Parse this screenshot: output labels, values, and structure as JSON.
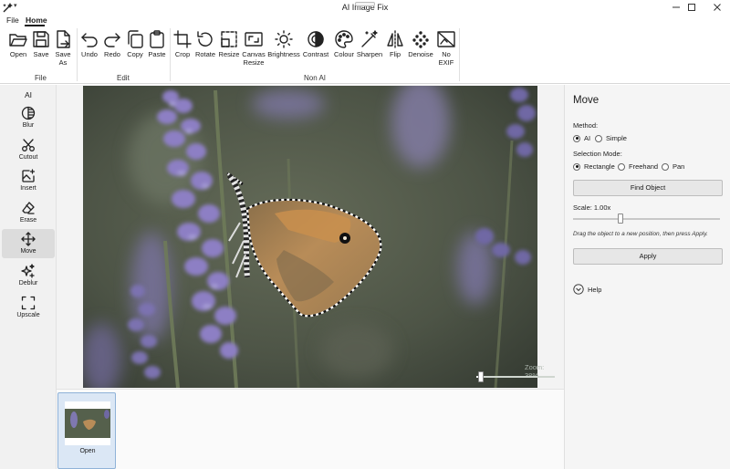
{
  "window": {
    "title": "AI Image Fix",
    "buttons": {
      "minimize": "minimize-icon",
      "maximize": "maximize-icon",
      "close": "close-icon"
    }
  },
  "menu": {
    "file": "File",
    "home": "Home"
  },
  "ribbon": {
    "groups": {
      "file": "File",
      "edit": "Edit",
      "nonai": "Non AI"
    },
    "tools": {
      "open": "Open",
      "save": "Save",
      "save_as_1": "Save",
      "save_as_2": "As",
      "undo": "Undo",
      "redo": "Redo",
      "copy": "Copy",
      "paste": "Paste",
      "crop": "Crop",
      "rotate": "Rotate",
      "resize": "Resize",
      "canvas_resize_1": "Canvas",
      "canvas_resize_2": "Resize",
      "brightness": "Brightness",
      "contrast": "Contrast",
      "colour": "Colour",
      "sharpen": "Sharpen",
      "flip": "Flip",
      "denoise": "Denoise",
      "no_exif_1": "No",
      "no_exif_2": "EXIF"
    }
  },
  "sidebar": {
    "heading": "AI",
    "items": {
      "blur": "Blur",
      "cutout": "Cutout",
      "insert": "Insert",
      "erase": "Erase",
      "move": "Move",
      "deblur": "Deblur",
      "upscale": "Upscale"
    },
    "active": "Move"
  },
  "canvas": {
    "zoom_label": "Zoom: 38%",
    "zoom_percent": 38
  },
  "filmstrip": {
    "items": [
      {
        "label": "Open"
      }
    ]
  },
  "panel": {
    "title": "Move",
    "method_label": "Method:",
    "method_options": {
      "ai": "AI",
      "simple": "Simple"
    },
    "method_selected": "AI",
    "selection_label": "Selection Mode:",
    "selection_options": {
      "rectangle": "Rectangle",
      "freehand": "Freehand",
      "pan": "Pan"
    },
    "selection_selected": "Rectangle",
    "find_button": "Find Object",
    "scale_label": "Scale: 1.00x",
    "scale_value": 1.0,
    "hint": "Drag the object to a new position, then press Apply.",
    "apply_button": "Apply",
    "help_label": "Help"
  },
  "colors": {
    "accent_selected": "#dbe7f5",
    "sidebar_bg": "#f1f1f1",
    "panel_bg": "#f5f5f5"
  }
}
